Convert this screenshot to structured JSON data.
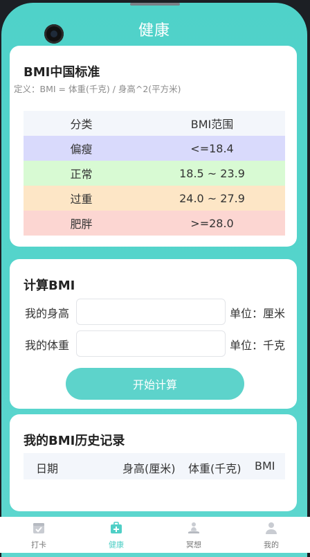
{
  "header": {
    "title": "健康"
  },
  "bmi_standard": {
    "title": "BMI中国标准",
    "definition": "定义：BMI = 体重(千克) / 身高^2(平方米)",
    "table": {
      "headers": [
        "分类",
        "BMI范围"
      ],
      "rows": [
        [
          "偏瘦",
          "<=18.4"
        ],
        [
          "正常",
          "18.5 ~ 23.9"
        ],
        [
          "过重",
          "24.0 ~ 27.9"
        ],
        [
          "肥胖",
          ">=28.0"
        ]
      ]
    }
  },
  "calculator": {
    "title": "计算BMI",
    "height_label": "我的身高",
    "height_value": "",
    "height_unit": "单位：厘米",
    "weight_label": "我的体重",
    "weight_value": "",
    "weight_unit": "单位：千克",
    "button_label": "开始计算"
  },
  "history": {
    "title": "我的BMI历史记录",
    "columns": [
      "日期",
      "身高(厘米)",
      "体重(千克)",
      "BMI"
    ]
  },
  "tabbar": {
    "items": [
      {
        "label": "打卡",
        "icon": "calendar-icon"
      },
      {
        "label": "健康",
        "icon": "medical-kit-icon",
        "active": true
      },
      {
        "label": "冥想",
        "icon": "meditation-icon"
      },
      {
        "label": "我的",
        "icon": "user-icon"
      }
    ]
  },
  "colors": {
    "accent": "#4fcfc6",
    "underweight_row": "#d9dafc",
    "normal_row": "#d8fad3",
    "overweight_row": "#fde6c6",
    "obese_row": "#fcd6d2"
  }
}
